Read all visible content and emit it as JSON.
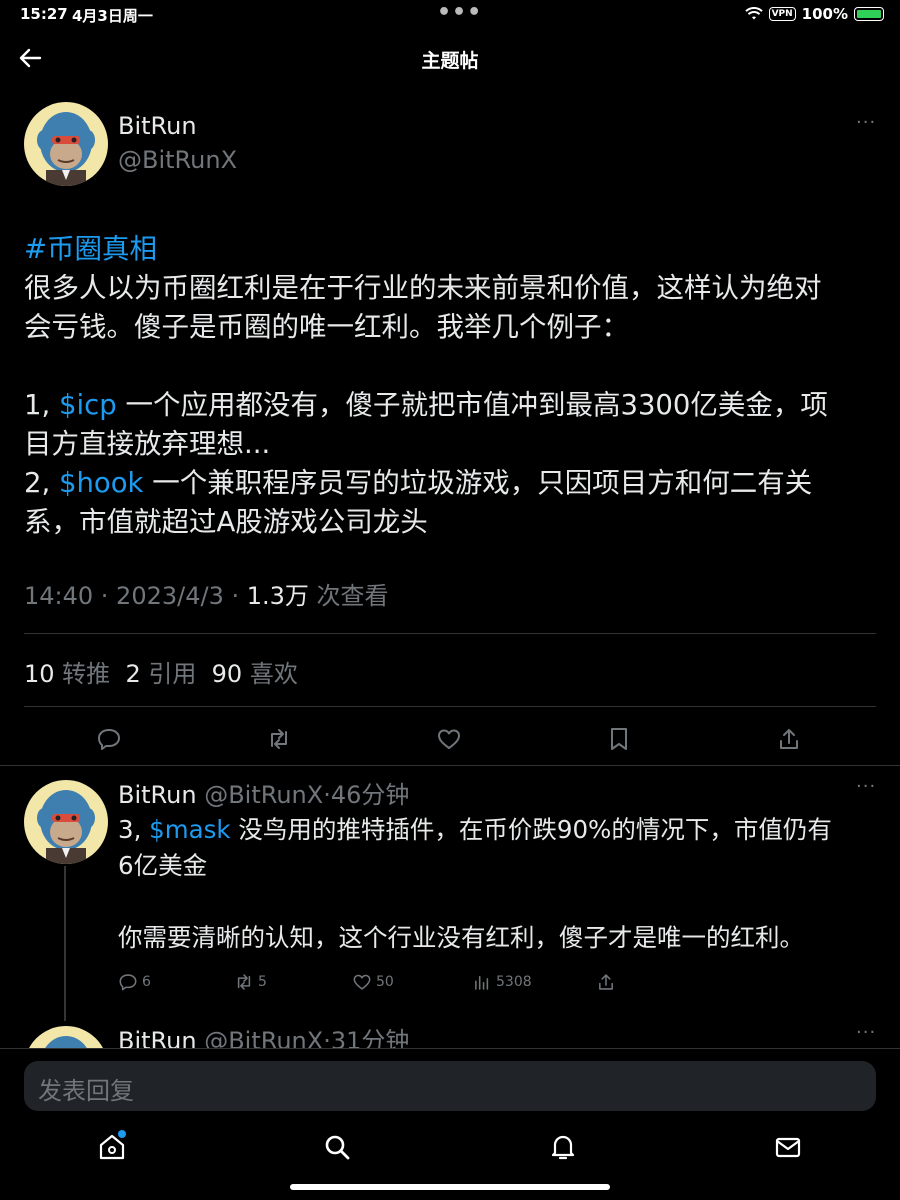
{
  "status_bar": {
    "time": "15:27",
    "date": "4月3日周一",
    "vpn": "VPN",
    "battery": "100%",
    "battery_level_percent": 100
  },
  "header": {
    "title": "主题帖"
  },
  "tweet": {
    "author_name": "BitRun",
    "author_handle": "@BitRunX",
    "hashtag": "#币圈真相",
    "line1": "很多人以为币圈红利是在于行业的未来前景和价值，这样认为绝对",
    "line2": "会亏钱。傻子是币圈的唯一红利。我举几个例子：",
    "item1_prefix": "1, ",
    "item1_cashtag": "$icp",
    "item1_text": " 一个应用都没有，傻子就把市值冲到最高3300亿美金，项",
    "item1_text2": "目方直接放弃理想...",
    "item2_prefix": "2, ",
    "item2_cashtag": "$hook",
    "item2_text": " 一个兼职程序员写的垃圾游戏，只因项目方和何二有关",
    "item2_text2": "系，市值就超过A股游戏公司龙头",
    "timestamp": "14:40 · 2023/4/3 · ",
    "views_count": "1.3万",
    "views_label": " 次查看",
    "retweets_count": "10",
    "retweets_label": " 转推",
    "quotes_count": "2",
    "quotes_label": " 引用",
    "likes_count": "90",
    "likes_label": " 喜欢"
  },
  "reply": {
    "author_name": "BitRun",
    "author_handle": " @BitRunX·46分钟",
    "prefix": "3, ",
    "cashtag": "$mask",
    "text1": " 没鸟用的推特插件，在币价跌90%的情况下，市值仍有",
    "text2": "6亿美金",
    "text3": "你需要清晰的认知，这个行业没有红利，傻子才是唯一的红利。",
    "replies": "6",
    "retweets": "5",
    "likes": "50",
    "views": "5308"
  },
  "reply2": {
    "author_name": "BitRun",
    "author_handle": " @BitRunX·31分钟"
  },
  "compose": {
    "placeholder": "发表回复"
  },
  "colors": {
    "accent": "#1d9bf0",
    "background": "#000000",
    "muted": "#71767b",
    "text": "#e7e9ea"
  }
}
